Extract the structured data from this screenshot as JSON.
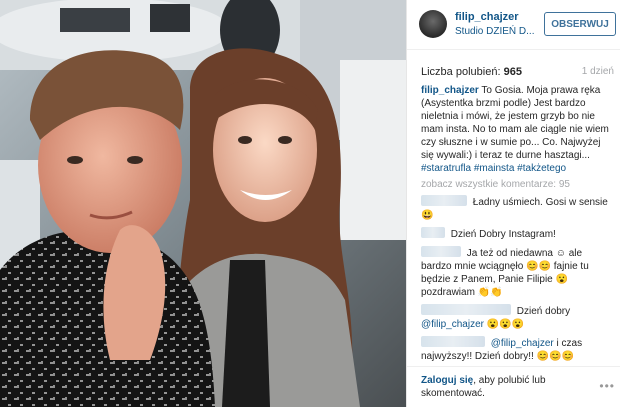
{
  "post": {
    "username": "filip_chajzer",
    "location": "Studio DZIEŃ D...",
    "follow_label": "OBSERWUJ",
    "likes_label": "Liczba polubień:",
    "likes_count": "965",
    "age": "1 dzień"
  },
  "caption": {
    "username": "filip_chajzer",
    "text": "To Gosia. Moja prawa ręka (Asystentka brzmi podle) Jest bardzo nieletnia i mówi, że jestem grzyb bo nie mam insta. No to mam ale ciągle nie wiem czy słuszne i w sumie po... Co. Najwyżej się wywali:) i teraz te durne hasztagi...",
    "tags": [
      "#staratrufla",
      "#mainsta",
      "#takżetego"
    ]
  },
  "view_all": "zobacz wszystkie komentarze: 95",
  "comments": [
    {
      "text": "Ładny uśmiech. Gosi w sensie",
      "emoji": "😃"
    },
    {
      "text": "Dzień Dobry Instagram!",
      "emoji": ""
    },
    {
      "text": "Ja też od niedawna ☺ ale bardzo mnie wciągnęło 😊😊 fajnie tu będzie z Panem, Panie Filipie 😮 pozdrawiam 👏👏",
      "emoji": ""
    },
    {
      "text": "Dzień dobry",
      "mention": "@filip_chajzer",
      "emoji": "😮😮😮"
    },
    {
      "mention": "@filip_chajzer",
      "text": "i czas najwyższy!! Dzień dobry!!",
      "emoji": "😊😊😊"
    }
  ],
  "footer": {
    "login_link": "Zaloguj się",
    "login_text": ", aby polubić lub skomentować.",
    "more_icon": "more-dots-icon",
    "more_glyph": "•••"
  },
  "colors": {
    "link": "#125688",
    "follow_border": "#3f729b",
    "muted": "#a5a7aa"
  }
}
